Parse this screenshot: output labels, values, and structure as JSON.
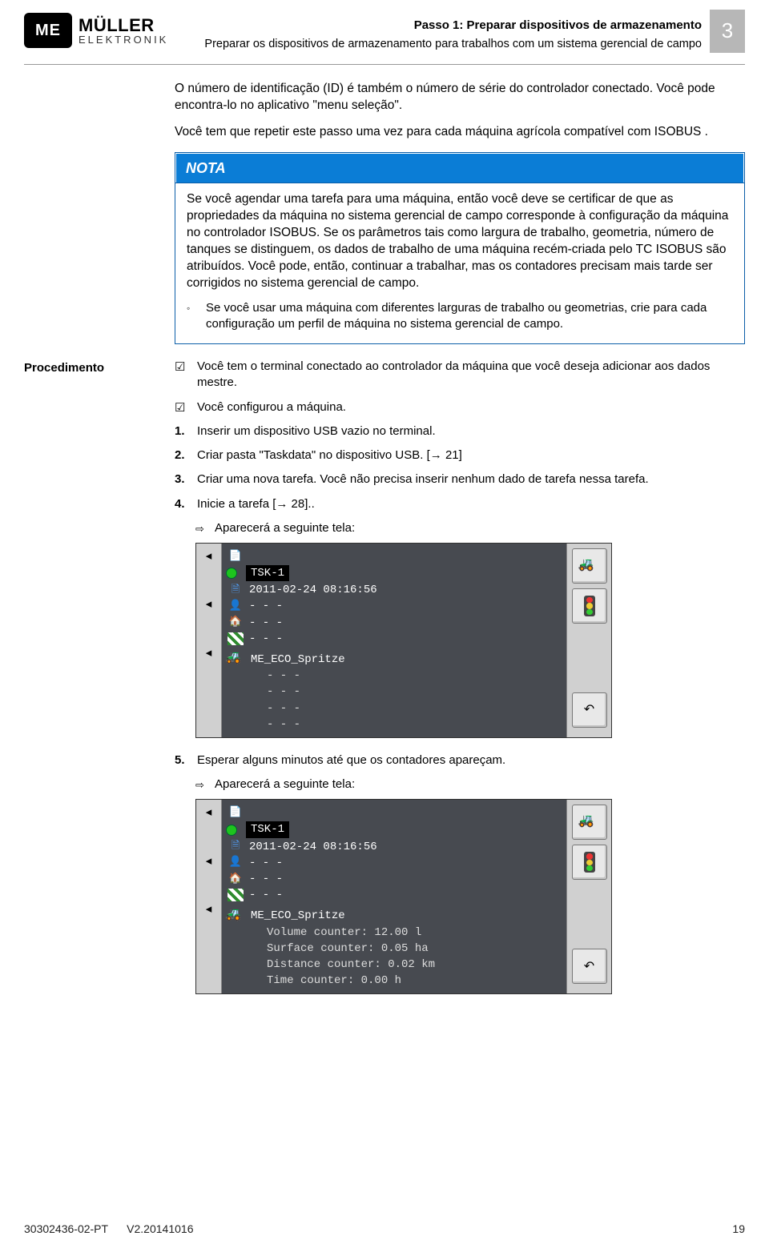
{
  "logo": {
    "badge": "ME",
    "brand": "MÜLLER",
    "sub": "ELEKTRONIK"
  },
  "header": {
    "title1": "Passo 1: Preparar dispositivos de armazenamento",
    "title2": "Preparar os dispositivos de armazenamento para trabalhos com um sistema gerencial de campo",
    "chapter": "3"
  },
  "intro": {
    "p1": "O número de identificação (ID) é também o número de série do controlador conectado. Você pode encontra-lo no aplicativo \"menu seleção\".",
    "p2": "Você tem que repetir este passo uma vez para cada máquina agrícola compatível com ISOBUS ."
  },
  "note": {
    "title": "NOTA",
    "p1": "Se você agendar uma tarefa para uma máquina, então você deve se certificar de que as propriedades da máquina no sistema gerencial de campo corresponde à configuração da máquina no controlador ISOBUS. Se os parâmetros tais como largura de trabalho, geometria, número de tanques se distinguem, os dados de trabalho de uma máquina recém-criada pelo TC ISOBUS são atribuídos. Você pode, então, continuar a trabalhar, mas os contadores precisam mais tarde ser corrigidos no sistema gerencial de campo.",
    "p2": "Se você usar uma máquina com diferentes larguras de trabalho ou geometrias, crie para cada configuração um perfil de máquina no sistema gerencial de campo."
  },
  "procedure": {
    "label": "Procedimento",
    "check1": "Você tem o terminal conectado ao controlador da máquina que você deseja adicionar aos dados mestre.",
    "check2": "Você configurou a máquina.",
    "step1": "Inserir um dispositivo USB vazio no terminal.",
    "step2": "Criar pasta \"Taskdata\" no dispositivo USB. [",
    "step2_ref": " 21]",
    "step3": "Criar uma nova tarefa. Você não precisa inserir nenhum dado de tarefa nessa tarefa.",
    "step4": "Inicie a tarefa [",
    "step4_ref": " 28]..",
    "result4": "Aparecerá a seguinte tela:",
    "step5": "Esperar alguns minutos até que os contadores apareçam.",
    "result5": "Aparecerá a seguinte tela:"
  },
  "terminal1": {
    "task": "TSK-1",
    "datetime": "2011-02-24 08:16:56",
    "dash1": "- - -",
    "dash2": "- - -",
    "dash3": "- - -",
    "machine": "ME_ECO_Spritze",
    "sub1": "- - -",
    "sub2": "- - -",
    "sub3": "- - -",
    "sub4": "- - -"
  },
  "terminal2": {
    "task": "TSK-1",
    "datetime": "2011-02-24 08:16:56",
    "dash1": "- - -",
    "dash2": "- - -",
    "dash3": "- - -",
    "machine": "ME_ECO_Spritze",
    "c1": "Volume counter: 12.00 l",
    "c2": "Surface counter: 0.05 ha",
    "c3": "Distance counter: 0.02 km",
    "c4": "Time counter: 0.00 h"
  },
  "footer": {
    "docnum": "30302436-02-PT",
    "version": "V2.20141016",
    "page": "19"
  }
}
